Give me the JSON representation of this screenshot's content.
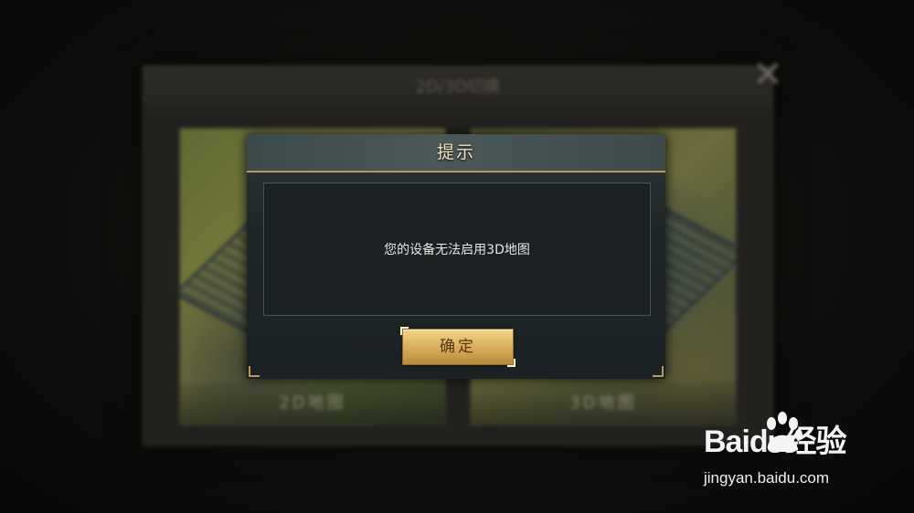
{
  "background_panel": {
    "title": "2D/3D切换",
    "close_symbol": "✕",
    "left_card_label": "2D地图",
    "right_card_label": "3D地图"
  },
  "dialog": {
    "title": "提示",
    "message": "您的设备无法启用3D地图",
    "confirm_label": "确定"
  },
  "watermark": {
    "brand_text": "Baidu经验",
    "url": "jingyan.baidu.com"
  },
  "colors": {
    "dialog_accent": "#b9985a",
    "button_gold": "#d8ae5c"
  }
}
